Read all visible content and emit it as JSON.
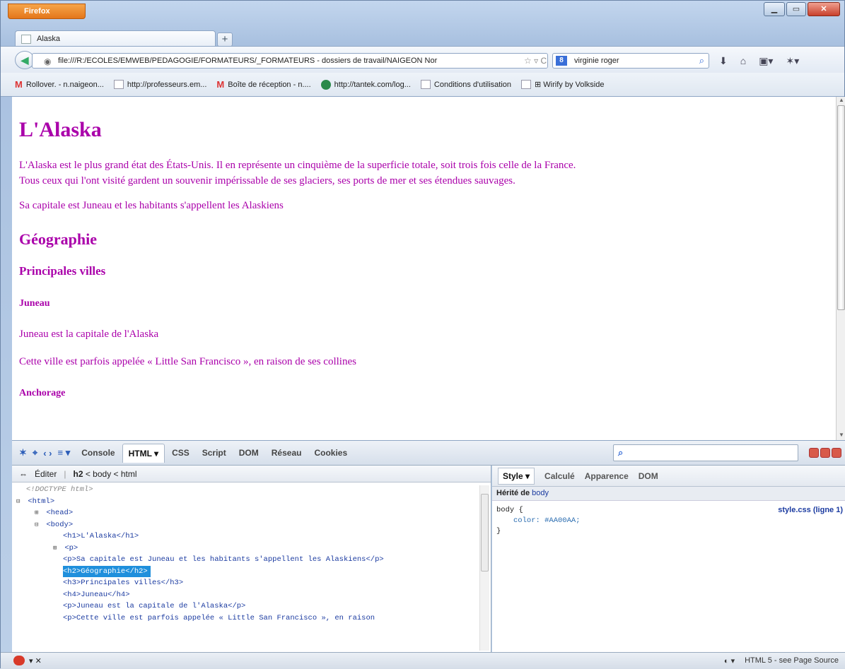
{
  "window": {
    "app_button": "Firefox",
    "controls": [
      "minimize",
      "maximize",
      "close"
    ]
  },
  "tabs": [
    {
      "label": "Alaska"
    }
  ],
  "nav": {
    "url": "file:///R:/ECOLES/EMWEB/PEDAGOGIE/FORMATEURS/_FORMATEURS - dossiers de travail/NAIGEON Nor",
    "search_value": "virginie roger"
  },
  "bookmarks": [
    {
      "label": "Rollover. - n.naigeon...",
      "icon": "gmail-icon"
    },
    {
      "label": "http://professeurs.em...",
      "icon": "page-icon"
    },
    {
      "label": "Boîte de réception - n....",
      "icon": "gmail-icon"
    },
    {
      "label": "http://tantek.com/log...",
      "icon": "globe-icon"
    },
    {
      "label": "Conditions d'utilisation",
      "icon": "page-icon"
    },
    {
      "label": "⊞ Wirify by Volkside",
      "icon": "page-icon"
    }
  ],
  "page": {
    "h1": "L'Alaska",
    "intro_line1": "L'Alaska est le plus grand état des États-Unis. Il en représente un cinquième de la superficie totale, soit trois fois celle de la France.",
    "intro_line2": "Tous ceux qui l'ont visité gardent un souvenir impérissable de ses glaciers, ses ports de mer et ses étendues sauvages.",
    "capital": "Sa capitale est Juneau et les habitants s'appellent les Alaskiens",
    "h2": "Géographie",
    "h3": "Principales villes",
    "h4_1": "Juneau",
    "p_juneau1": "Juneau est la capitale de l'Alaska",
    "p_juneau2": "Cette ville est parfois appelée « Little San Francisco », en raison de ses collines",
    "h4_2": "Anchorage",
    "text_color": "#AA00AA"
  },
  "firebug": {
    "tabs": [
      "Console",
      "HTML ▾",
      "CSS",
      "Script",
      "DOM",
      "Réseau",
      "Cookies"
    ],
    "active_tab": "HTML ▾",
    "edit_label": "Éditer",
    "breadcrumb_sel": "h2",
    "breadcrumb_rest": "< body < html",
    "tree": [
      {
        "indent": 0,
        "exp": "",
        "text": "<!DOCTYPE html>",
        "kind": "comment"
      },
      {
        "indent": 0,
        "exp": "⊟",
        "text": "<html>",
        "kind": "tag"
      },
      {
        "indent": 1,
        "exp": "⊞",
        "text": "<head>",
        "kind": "tag"
      },
      {
        "indent": 1,
        "exp": "⊟",
        "text": "<body>",
        "kind": "tag"
      },
      {
        "indent": 2,
        "exp": "",
        "text": "<h1>L'Alaska</h1>",
        "kind": "tag"
      },
      {
        "indent": 2,
        "exp": "⊞",
        "text": "<p>",
        "kind": "tag"
      },
      {
        "indent": 2,
        "exp": "",
        "text": "<p>Sa capitale est Juneau et les habitants s'appellent les Alaskiens</p>",
        "kind": "tag"
      },
      {
        "indent": 2,
        "exp": "",
        "text": "<h2>Géographie</h2>",
        "kind": "tag",
        "selected": true
      },
      {
        "indent": 2,
        "exp": "",
        "text": "<h3>Principales villes</h3>",
        "kind": "tag"
      },
      {
        "indent": 2,
        "exp": "",
        "text": "<h4>Juneau</h4>",
        "kind": "tag"
      },
      {
        "indent": 2,
        "exp": "",
        "text": "<p>Juneau est la capitale de l'Alaska</p>",
        "kind": "tag"
      },
      {
        "indent": 2,
        "exp": "",
        "text": "<p>Cette ville est parfois appelée « Little San Francisco », en raison",
        "kind": "tag"
      }
    ],
    "style_tabs": [
      "Style ▾",
      "Calculé",
      "Apparence",
      "DOM"
    ],
    "inherited_label": "Hérité de",
    "inherited_from": "body",
    "rule_selector": "body {",
    "rule_prop": "color: #AA00AA;",
    "rule_close": "}",
    "rule_source": "style.css (ligne 1)"
  },
  "status": {
    "right": "HTML 5 - see Page Source"
  }
}
